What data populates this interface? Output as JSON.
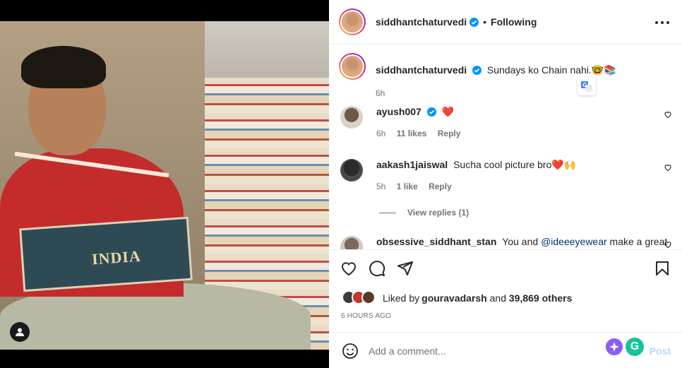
{
  "header": {
    "username": "siddhantchaturvedi",
    "separator": "•",
    "follow_state": "Following"
  },
  "caption": {
    "username": "siddhantchaturvedi",
    "text": "Sundays ko Chain nahi.",
    "emojis": "🤓📚",
    "time": "6h"
  },
  "comments": [
    {
      "username": "ayush007",
      "text": "",
      "emoji": "❤️",
      "time": "6h",
      "likes": "11 likes",
      "reply": "Reply",
      "verified": true
    },
    {
      "username": "aakash1jaiswal",
      "text": "Sucha cool picture bro",
      "emoji": "❤️🙌",
      "time": "5h",
      "likes": "1 like",
      "reply": "Reply",
      "verified": false
    },
    {
      "username": "obsessive_siddhant_stan",
      "text_before": "You and ",
      "mention": "@ideeeyewear",
      "text_after": " make a great",
      "verified": false
    }
  ],
  "view_replies": "View replies (1)",
  "likes": {
    "prefix": "Liked by ",
    "first_liker": "gouravadarsh",
    "middle": " and ",
    "others": "39,869 others"
  },
  "timestamp": "6 HOURS AGO",
  "add_comment": {
    "placeholder": "Add a comment...",
    "post_label": "Post"
  },
  "photo": {
    "book_title": "INDIA"
  },
  "colors": {
    "verified_blue": "#0095f6",
    "heart_red": "#ff3040",
    "post_disabled": "#b3dbff",
    "secondary_text": "#737373"
  },
  "icons": [
    "verified-badge-icon",
    "more-options-icon",
    "translate-icon",
    "like-heart-icon",
    "comment-icon",
    "share-icon",
    "save-bookmark-icon",
    "emoji-icon",
    "ai-sparkle-icon",
    "grammarly-icon",
    "user-tag-icon"
  ]
}
